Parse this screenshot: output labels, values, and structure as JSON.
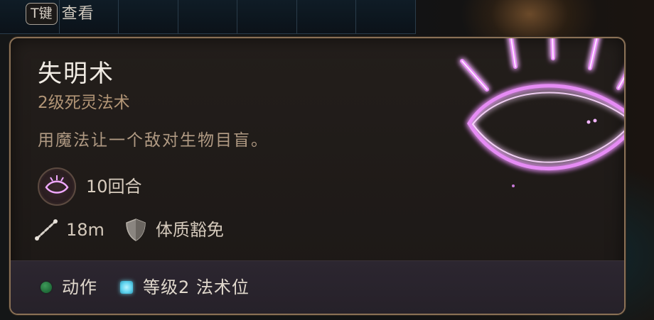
{
  "hint": {
    "key": "T键",
    "action": "查看"
  },
  "spell": {
    "name": "失明术",
    "level_school": "2级死灵法术",
    "description": "用魔法让一个敌对生物目盲。",
    "duration": "10回合",
    "range": "18m",
    "saving_throw": "体质豁免",
    "icon": "blind-eye-icon"
  },
  "footer": {
    "action_cost": "动作",
    "resource": "等级2 法术位"
  },
  "colors": {
    "accent_magenta": "#e070f0",
    "action_green": "#2f8a4a",
    "spell_slot_blue": "#61d4ef",
    "panel_border": "#8a7156"
  }
}
